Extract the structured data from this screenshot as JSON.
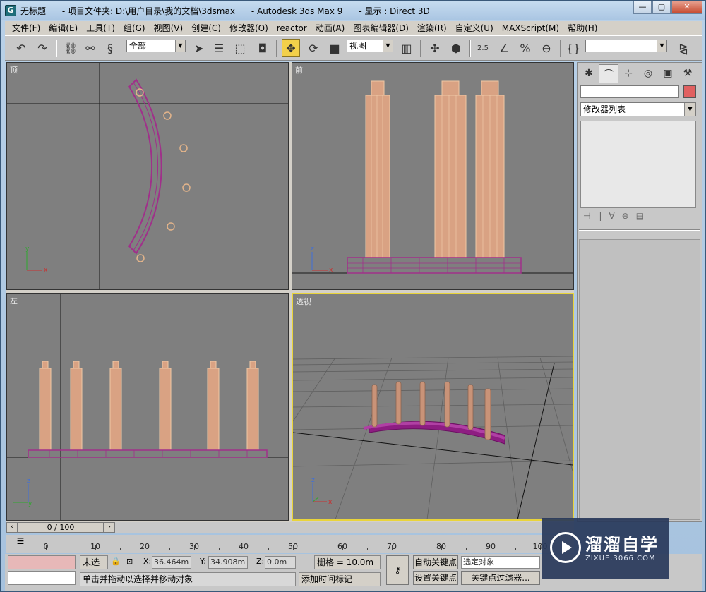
{
  "window": {
    "title": "无标题      - 项目文件夹: D:\\用户目录\\我的文档\\3dsmax      - Autodesk 3ds Max 9      - 显示 : Direct 3D",
    "buttons": {
      "minimize": "—",
      "maximize": "▢",
      "close": "✕"
    }
  },
  "menu": [
    "文件(F)",
    "编辑(E)",
    "工具(T)",
    "组(G)",
    "视图(V)",
    "创建(C)",
    "修改器(O)",
    "reactor",
    "动画(A)",
    "图表编辑器(D)",
    "渲染(R)",
    "自定义(U)",
    "MAXScript(M)",
    "帮助(H)"
  ],
  "toolbar": {
    "selection_filter": "全部",
    "ref_coord": "视图",
    "snap_value": "2.5",
    "named_selection": ""
  },
  "viewports": {
    "top": {
      "label": "顶"
    },
    "front": {
      "label": "前"
    },
    "left": {
      "label": "左"
    },
    "perspective": {
      "label": "透视"
    }
  },
  "command_panel": {
    "modifier_list": "修改器列表",
    "object_color": "#e06060"
  },
  "time_slider": {
    "frame": "0 / 100"
  },
  "track_bar": {
    "ticks": [
      "0",
      "10",
      "20",
      "30",
      "40",
      "50",
      "60",
      "70",
      "80",
      "90",
      "100"
    ]
  },
  "status": {
    "selection": "未选",
    "x_label": "X:",
    "x_value": "36.464m",
    "y_label": "Y:",
    "y_value": "34.908m",
    "z_label": "Z:",
    "z_value": "0.0m",
    "grid": "栅格 = 10.0m",
    "auto_key": "自动关键点",
    "set_key": "设置关键点",
    "key_mode": "选定对象",
    "key_filters": "关键点过滤器...",
    "prompt": "单击并拖动以选择并移动对象",
    "add_time_tag": "添加时间标记"
  },
  "watermark": {
    "title": "溜溜自学",
    "url": "ZIXUE.3066.COM"
  }
}
